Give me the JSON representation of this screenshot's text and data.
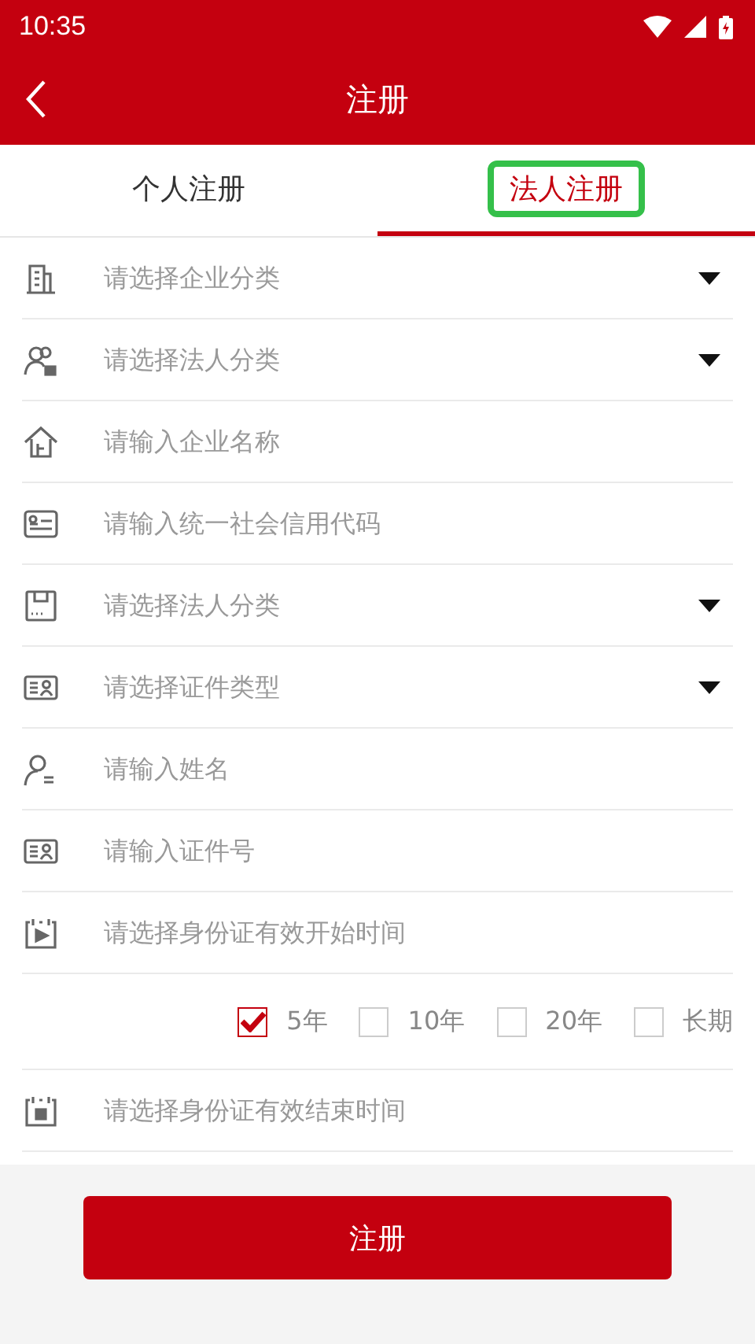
{
  "status_bar": {
    "time": "10:35"
  },
  "header": {
    "title": "注册"
  },
  "tabs": [
    {
      "label": "个人注册",
      "selected": false
    },
    {
      "label": "法人注册",
      "selected": true
    }
  ],
  "form": [
    {
      "kind": "select",
      "placeholder": "请选择企业分类"
    },
    {
      "kind": "select",
      "placeholder": "请选择法人分类"
    },
    {
      "kind": "input",
      "placeholder": "请输入企业名称"
    },
    {
      "kind": "input",
      "placeholder": "请输入统一社会信用代码"
    },
    {
      "kind": "select",
      "placeholder": "请选择法人分类"
    },
    {
      "kind": "select",
      "placeholder": "请选择证件类型"
    },
    {
      "kind": "input",
      "placeholder": "请输入姓名"
    },
    {
      "kind": "input",
      "placeholder": "请输入证件号"
    },
    {
      "kind": "input",
      "placeholder": "请选择身份证有效开始时间"
    },
    {
      "kind": "options",
      "options": [
        {
          "label": "5年",
          "checked": true
        },
        {
          "label": "10年",
          "checked": false
        },
        {
          "label": "20年",
          "checked": false
        },
        {
          "label": "长期",
          "checked": false
        }
      ]
    },
    {
      "kind": "input",
      "placeholder": "请选择身份证有效结束时间"
    }
  ],
  "submit": "注册"
}
